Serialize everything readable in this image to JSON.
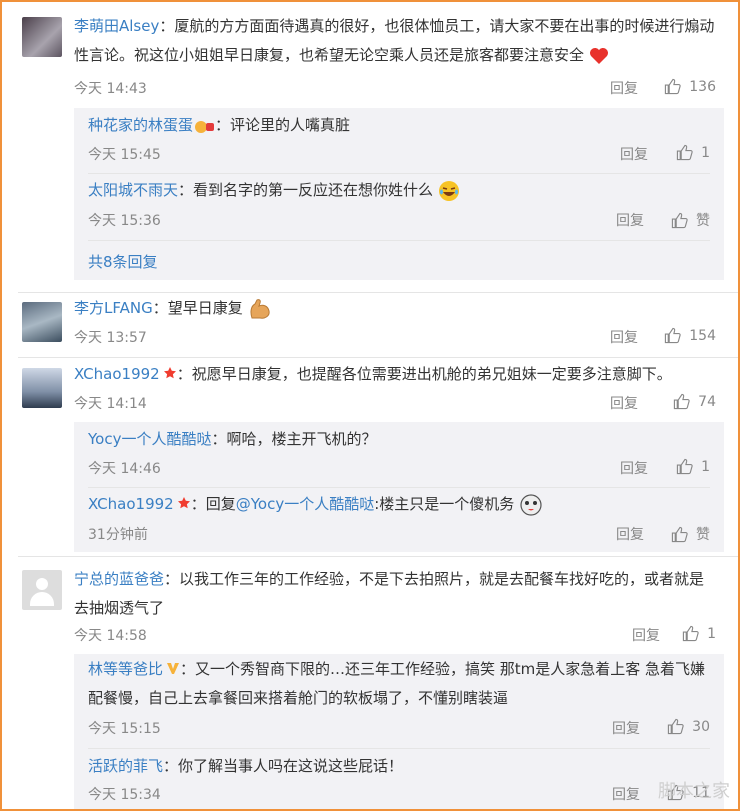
{
  "comments": [
    {
      "user": "李萌田Alsey",
      "text": "：厦航的方方面面待遇真的很好，也很体恤员工，请大家不要在出事的时候进行煽动性言论。祝这位小姐姐早日康复，也希望无论空乘人员还是旅客都要注意安全",
      "time": "今天 14:43",
      "reply": "回复",
      "likes": "136",
      "replies": [
        {
          "user": "种花家的林蛋蛋",
          "text": "：评论里的人嘴真脏",
          "time": "今天 15:45",
          "reply": "回复",
          "likes": "1"
        },
        {
          "user": "太阳城不雨天",
          "text": "：看到名字的第一反应还在想你姓什么",
          "time": "今天 15:36",
          "reply": "回复",
          "likes": "赞"
        }
      ],
      "more": "共8条回复"
    },
    {
      "user": "李方LFANG",
      "text": "：望早日康复",
      "time": "今天 13:57",
      "reply": "回复",
      "likes": "154"
    },
    {
      "user": "XChao1992",
      "text": "：祝愿早日康复，也提醒各位需要进出机舱的弟兄姐妹一定要多注意脚下。",
      "time": "今天 14:14",
      "reply": "回复",
      "likes": "74",
      "replies": [
        {
          "user": "Yocy一个人酷酷哒",
          "text": "：啊哈，楼主开飞机的？",
          "time": "今天 14:46",
          "reply": "回复",
          "likes": "1"
        },
        {
          "user": "XChao1992",
          "text_pre": "：回复",
          "mention": "@Yocy一个人酷酷哒",
          "text": ":楼主只是一个傻机务",
          "time": "31分钟前",
          "reply": "回复",
          "likes": "赞"
        }
      ]
    },
    {
      "user": "宁总的蓝爸爸",
      "text": "：以我工作三年的工作经验，不是下去拍照片，就是去配餐车找好吃的，或者就是去抽烟透气了",
      "time": "今天 14:58",
      "reply": "回复",
      "likes": "1",
      "replies": [
        {
          "user": "林等等爸比",
          "text": "：又一个秀智商下限的…还三年工作经验，搞笑  那tm是人家急着上客 急着飞嫌配餐慢，自己上去拿餐回来搭着舱门的软板塌了，不懂别瞎装逼",
          "time": "今天 15:15",
          "reply": "回复",
          "likes": "30"
        },
        {
          "user": "活跃的菲飞",
          "text": "：你了解当事人吗在这说这些屁话！",
          "time": "今天 15:34",
          "reply": "回复",
          "likes": "11"
        }
      ]
    }
  ],
  "colors": {
    "link": "#3a7fc3",
    "frame": "#f0913a",
    "reply_bg": "#f2f2f5",
    "meta": "#888888"
  },
  "watermark": "脚本之家"
}
